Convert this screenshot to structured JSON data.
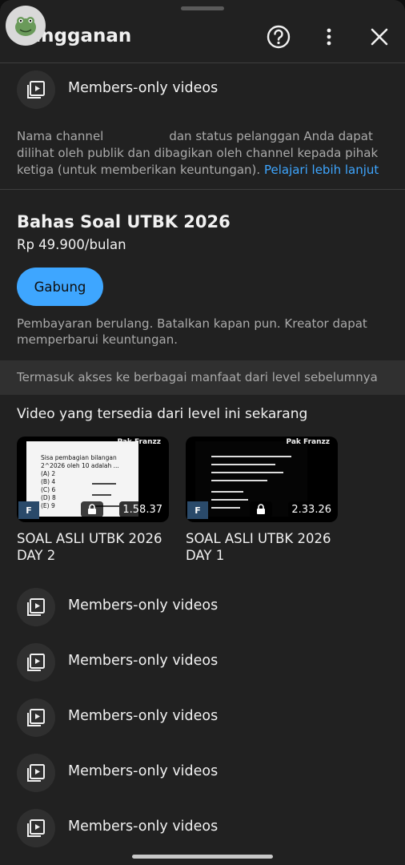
{
  "header": {
    "title": "Langganan",
    "icons": [
      "help-icon",
      "more-vert-icon",
      "close-icon"
    ]
  },
  "perks_top": {
    "label": "Members-only videos",
    "icon": "video-library-icon"
  },
  "notice": {
    "text_before": "Nama channel",
    "text_after": "dan status pelanggan Anda dapat dilihat oleh publik dan dibagikan oleh channel kepada pihak ketiga (untuk memberikan keuntungan).",
    "link": "Pelajari lebih lanjut"
  },
  "tier": {
    "name": "Bahas Soal UTBK 2026",
    "price": "Rp 49.900/bulan",
    "join_label": "Gabung",
    "billing_note": "Pembayaran berulang. Batalkan kapan pun. Kreator dapat memperbarui keuntungan."
  },
  "banner": "Termasuk akses ke berbagai manfaat dari level sebelumnya",
  "videos_section": {
    "title": "Video yang tersedia dari level ini sekarang",
    "videos": [
      {
        "title": "SOAL ASLI UTBK 2026 DAY 2",
        "duration": "1.58.37",
        "brand": "Pak Franzz",
        "question": "Sisa pembagian bilangan 2^2026 oleh 10 adalah ...",
        "options": [
          "(A) 2",
          "(B) 4",
          "(C) 6",
          "(D) 8",
          "(E) 9"
        ]
      },
      {
        "title": "SOAL ASLI UTBK 2026 DAY 1",
        "duration": "2.33.26",
        "brand": "Pak Franzz"
      }
    ]
  },
  "perks": [
    {
      "label": "Members-only videos"
    },
    {
      "label": "Members-only videos"
    },
    {
      "label": "Members-only videos"
    },
    {
      "label": "Members-only videos"
    },
    {
      "label": "Members-only videos"
    }
  ],
  "colors": {
    "accent": "#3ea6ff",
    "background": "#212121",
    "text": "#f1f1f1",
    "muted": "#aaaaaa"
  }
}
